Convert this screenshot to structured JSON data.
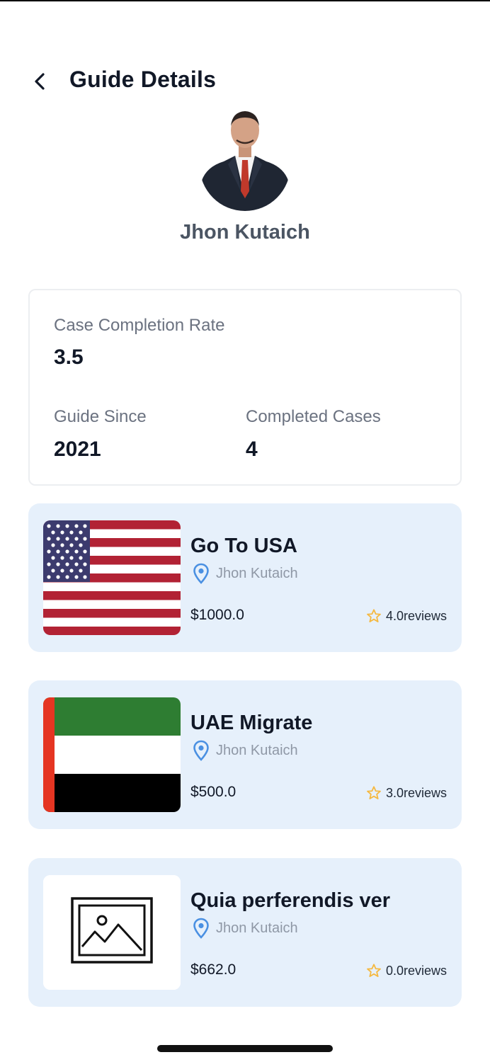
{
  "header": {
    "title": "Guide Details",
    "back_icon": "chevron-left-icon"
  },
  "profile": {
    "name": "Jhon Kutaich"
  },
  "stats": {
    "completion_rate_label": "Case Completion Rate",
    "completion_rate_value": "3.5",
    "guide_since_label": "Guide Since",
    "guide_since_value": "2021",
    "completed_cases_label": "Completed Cases",
    "completed_cases_value": "4"
  },
  "cases": [
    {
      "title": "Go To USA",
      "guide": "Jhon Kutaich",
      "price": "$1000.0",
      "reviews": "4.0reviews",
      "image": "usa-flag"
    },
    {
      "title": "UAE Migrate",
      "guide": "Jhon Kutaich",
      "price": "$500.0",
      "reviews": "3.0reviews",
      "image": "uae-flag"
    },
    {
      "title": "Quia perferendis ver",
      "guide": "Jhon Kutaich",
      "price": "$662.0",
      "reviews": "0.0reviews",
      "image": "image-placeholder-icon"
    }
  ],
  "colors": {
    "card_background": "#e6f0fb",
    "location_pin": "#4a90e2",
    "star": "#f5b942",
    "title_text": "#111827",
    "muted_text": "#6b7280"
  }
}
